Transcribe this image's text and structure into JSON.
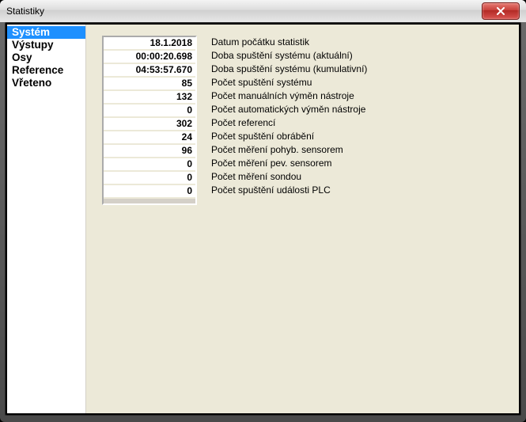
{
  "window": {
    "title": "Statistiky"
  },
  "sidebar": {
    "items": [
      {
        "label": "Systém",
        "selected": true
      },
      {
        "label": "Výstupy",
        "selected": false
      },
      {
        "label": "Osy",
        "selected": false
      },
      {
        "label": "Reference",
        "selected": false
      },
      {
        "label": "Vřeteno",
        "selected": false
      }
    ]
  },
  "stats": [
    {
      "value": "18.1.2018",
      "label": "Datum počátku statistik"
    },
    {
      "value": "00:00:20.698",
      "label": "Doba spuštění systému (aktuální)"
    },
    {
      "value": "04:53:57.670",
      "label": "Doba spuštění systému (kumulativní)"
    },
    {
      "value": "85",
      "label": "Počet spuštění systému"
    },
    {
      "value": "132",
      "label": "Počet manuálních výměn nástroje"
    },
    {
      "value": "0",
      "label": "Počet automatických výměn nástroje"
    },
    {
      "value": "302",
      "label": "Počet referencí"
    },
    {
      "value": "24",
      "label": "Počet spuštění obrábění"
    },
    {
      "value": "96",
      "label": "Počet měření pohyb. sensorem"
    },
    {
      "value": "0",
      "label": "Počet měření pev. sensorem"
    },
    {
      "value": "0",
      "label": "Počet měření sondou"
    },
    {
      "value": "0",
      "label": "Počet spuštění události PLC"
    }
  ]
}
